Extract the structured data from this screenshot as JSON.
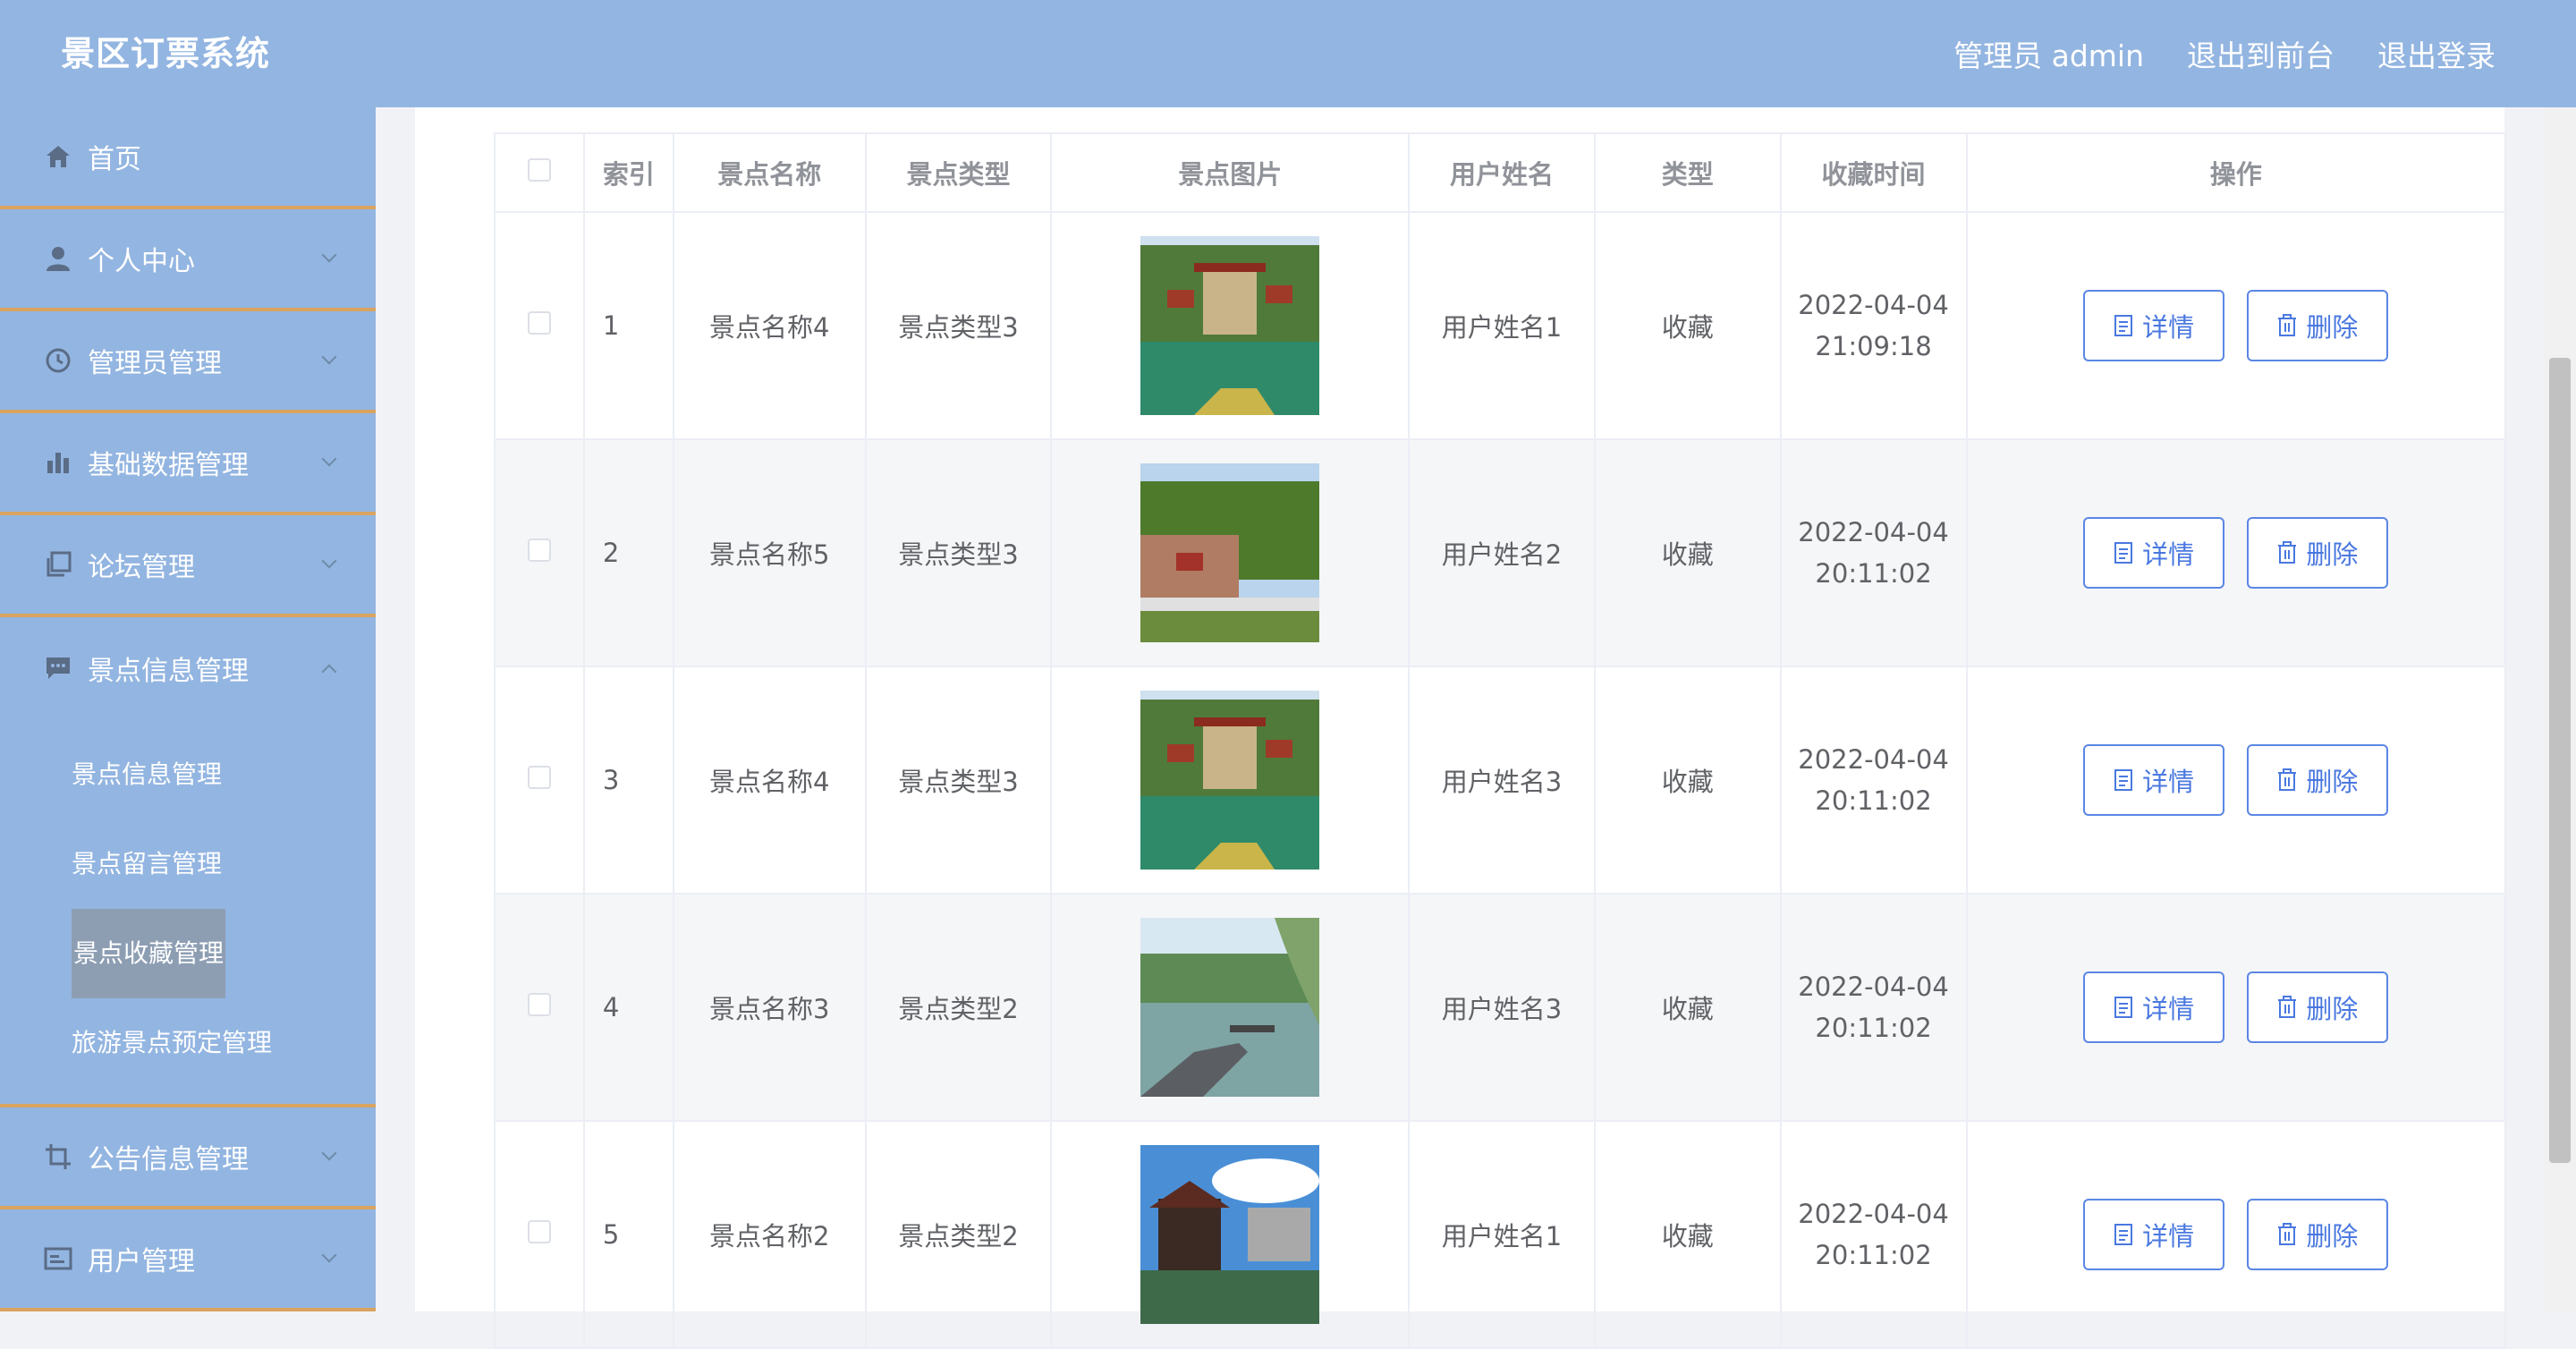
{
  "header": {
    "brand": "景区订票系统",
    "user": "管理员 admin",
    "to_front": "退出到前台",
    "logout": "退出登录"
  },
  "sidebar": {
    "items": [
      {
        "label": "首页",
        "icon": "home-icon"
      },
      {
        "label": "个人中心",
        "icon": "user-icon"
      },
      {
        "label": "管理员管理",
        "icon": "clock-icon"
      },
      {
        "label": "基础数据管理",
        "icon": "bar-chart-icon"
      },
      {
        "label": "论坛管理",
        "icon": "copy-icon"
      },
      {
        "label": "景点信息管理",
        "icon": "chat-icon"
      }
    ],
    "sub_items": [
      {
        "label": "景点信息管理"
      },
      {
        "label": "景点留言管理"
      },
      {
        "label": "景点收藏管理"
      },
      {
        "label": "旅游景点预定管理"
      }
    ],
    "items_after": [
      {
        "label": "公告信息管理",
        "icon": "crop-icon"
      },
      {
        "label": "用户管理",
        "icon": "card-icon"
      }
    ]
  },
  "table": {
    "headers": {
      "index": "索引",
      "name": "景点名称",
      "type": "景点类型",
      "image": "景点图片",
      "username": "用户姓名",
      "kind": "类型",
      "time": "收藏时间",
      "ops": "操作"
    },
    "detail_label": "详情",
    "delete_label": "删除",
    "rows": [
      {
        "index": "1",
        "name": "景点名称4",
        "type": "景点类型3",
        "username": "用户姓名1",
        "kind": "收藏",
        "date": "2022-04-04",
        "clock": "21:09:18"
      },
      {
        "index": "2",
        "name": "景点名称5",
        "type": "景点类型3",
        "username": "用户姓名2",
        "kind": "收藏",
        "date": "2022-04-04",
        "clock": "20:11:02"
      },
      {
        "index": "3",
        "name": "景点名称4",
        "type": "景点类型3",
        "username": "用户姓名3",
        "kind": "收藏",
        "date": "2022-04-04",
        "clock": "20:11:02"
      },
      {
        "index": "4",
        "name": "景点名称3",
        "type": "景点类型2",
        "username": "用户姓名3",
        "kind": "收藏",
        "date": "2022-04-04",
        "clock": "20:11:02"
      },
      {
        "index": "5",
        "name": "景点名称2",
        "type": "景点类型2",
        "username": "用户姓名1",
        "kind": "收藏",
        "date": "2022-04-04",
        "clock": "20:11:02"
      }
    ]
  },
  "colors": {
    "header_bg": "#93b5e1",
    "divider": "#d9a45f",
    "button": "#4a78e0"
  }
}
